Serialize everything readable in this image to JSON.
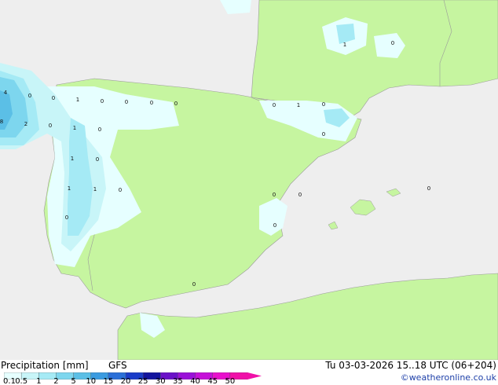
{
  "header": {
    "title": "Precipitation [mm]",
    "model": "GFS",
    "valid_time": "Tu 03-03-2026 15..18 UTC (06+204)",
    "credit": "©weatheronline.co.uk"
  },
  "legend": {
    "ticks": [
      "0.1",
      "0.5",
      "1",
      "2",
      "5",
      "10",
      "15",
      "20",
      "25",
      "30",
      "35",
      "40",
      "45",
      "50"
    ],
    "colors": [
      "#e6ffff",
      "#c8f5f8",
      "#a5eaf5",
      "#7dd6ee",
      "#5bbfe6",
      "#3a9be0",
      "#2a6fd8",
      "#1a3cc8",
      "#12149e",
      "#6a10c8",
      "#9a10d8",
      "#c510d8",
      "#e810cc",
      "#f010a8"
    ]
  },
  "colors": {
    "land": "#c6f5a0",
    "sea": "#eeeeee",
    "border": "#9a9a9a"
  },
  "map": {
    "labels": [
      {
        "text": "1"
      },
      {
        "text": "0"
      },
      {
        "text": "4"
      },
      {
        "text": "0"
      },
      {
        "text": "0"
      },
      {
        "text": "1"
      },
      {
        "text": "0"
      },
      {
        "text": "0"
      },
      {
        "text": "0"
      },
      {
        "text": "0"
      },
      {
        "text": "8"
      },
      {
        "text": "2"
      },
      {
        "text": "0"
      },
      {
        "text": "1"
      },
      {
        "text": "0"
      },
      {
        "text": "0"
      },
      {
        "text": "1"
      },
      {
        "text": "0"
      },
      {
        "text": "0"
      },
      {
        "text": "1"
      },
      {
        "text": "0"
      },
      {
        "text": "1"
      },
      {
        "text": "0"
      },
      {
        "text": "1"
      },
      {
        "text": "0"
      },
      {
        "text": "0"
      },
      {
        "text": "0"
      },
      {
        "text": "0"
      },
      {
        "text": "0"
      },
      {
        "text": "0"
      }
    ]
  }
}
